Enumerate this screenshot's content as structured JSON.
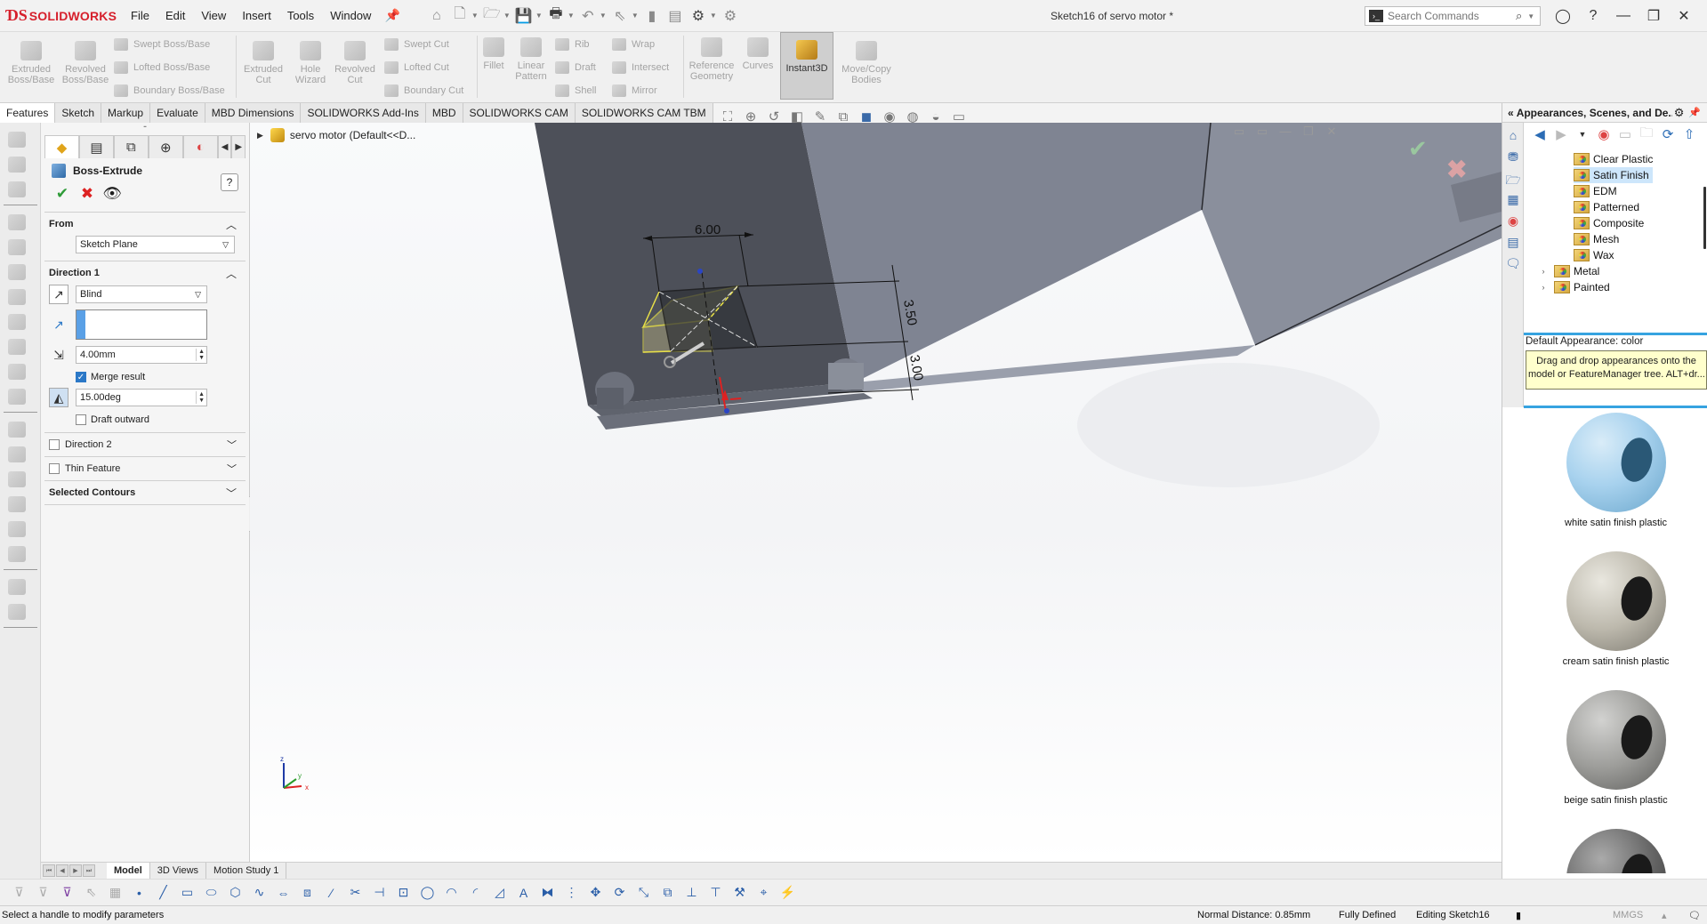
{
  "app": {
    "logo_text": "SOLIDWORKS",
    "menus": [
      "File",
      "Edit",
      "View",
      "Insert",
      "Tools",
      "Window"
    ],
    "doc_title": "Sketch16 of servo motor *",
    "search_placeholder": "Search Commands"
  },
  "ribbon": {
    "extruded_boss": "Extruded Boss/Base",
    "revolved_boss": "Revolved Boss/Base",
    "swept_boss": "Swept Boss/Base",
    "lofted_boss": "Lofted Boss/Base",
    "boundary_boss": "Boundary Boss/Base",
    "extruded_cut": "Extruded Cut",
    "hole_wizard": "Hole Wizard",
    "revolved_cut": "Revolved Cut",
    "swept_cut": "Swept Cut",
    "lofted_cut": "Lofted Cut",
    "boundary_cut": "Boundary Cut",
    "fillet": "Fillet",
    "linear_pattern": "Linear Pattern",
    "rib": "Rib",
    "draft": "Draft",
    "shell": "Shell",
    "wrap": "Wrap",
    "intersect": "Intersect",
    "mirror": "Mirror",
    "reference_geometry": "Reference Geometry",
    "curves": "Curves",
    "instant3d": "Instant3D",
    "move_copy": "Move/Copy Bodies"
  },
  "tabs": [
    "Features",
    "Sketch",
    "Markup",
    "Evaluate",
    "MBD Dimensions",
    "SOLIDWORKS Add-Ins",
    "MBD",
    "SOLIDWORKS CAM",
    "SOLIDWORKS CAM TBM"
  ],
  "property_manager": {
    "title": "Boss-Extrude",
    "from_label": "From",
    "from_value": "Sketch Plane",
    "direction1_label": "Direction 1",
    "end_condition": "Blind",
    "depth": "4.00mm",
    "merge_result": "Merge result",
    "draft_angle": "15.00deg",
    "draft_outward": "Draft outward",
    "direction2_label": "Direction 2",
    "thin_feature_label": "Thin Feature",
    "selected_contours_label": "Selected Contours"
  },
  "graphics": {
    "tree_root": "servo motor  (Default<<D...",
    "dim_width": "6.00",
    "dim_height": "3.50",
    "dim_depth": "3.00",
    "triad_z": "z",
    "triad_x": "x",
    "triad_y": "y"
  },
  "bottom_tabs": [
    "Model",
    "3D Views",
    "Motion Study 1"
  ],
  "status": {
    "message": "Select a handle to modify parameters",
    "normal_distance": "Normal Distance: 0.85mm",
    "defined": "Fully Defined",
    "editing": "Editing Sketch16",
    "units": "MMGS"
  },
  "taskpane": {
    "title": "Appearances, Scenes, and De...",
    "tree": [
      "Clear Plastic",
      "Satin Finish",
      "EDM",
      "Patterned",
      "Composite",
      "Mesh",
      "Wax",
      "Metal",
      "Painted"
    ],
    "default_appearance": "Default Appearance: color",
    "tooltip_line1": "Drag and drop appearances onto the",
    "tooltip_line2": "model or FeatureManager tree.  ALT+dr...",
    "swatches": [
      "white satin finish plastic",
      "cream satin finish plastic",
      "beige satin finish plastic"
    ]
  }
}
